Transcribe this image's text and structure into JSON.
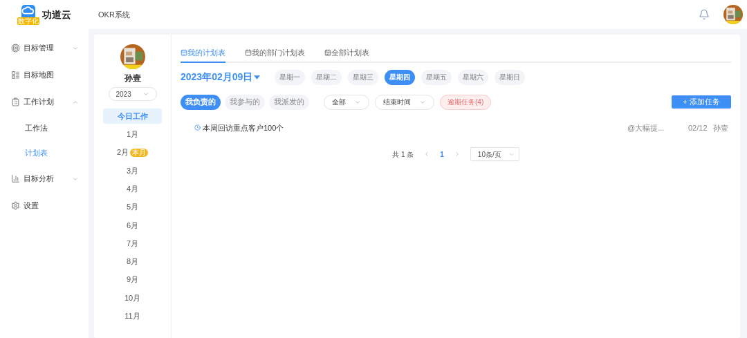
{
  "header": {
    "brand": "功道云",
    "badge": "数字化",
    "system": "OKR系统"
  },
  "sidebar": {
    "items": [
      {
        "label": "目标管理",
        "expanded": false,
        "selected": false
      },
      {
        "label": "目标地图",
        "selected": false
      },
      {
        "label": "工作计划",
        "expanded": true,
        "selected": false,
        "children": [
          {
            "label": "工作法",
            "selected": false
          },
          {
            "label": "计划表",
            "selected": true
          }
        ]
      },
      {
        "label": "目标分析",
        "expanded": false,
        "selected": false
      },
      {
        "label": "设置",
        "selected": false
      }
    ]
  },
  "profile": {
    "name": "孙壹",
    "year": "2023"
  },
  "months": [
    {
      "label": "今日工作",
      "selected": true
    },
    {
      "label": "1月",
      "selected": false
    },
    {
      "label": "2月",
      "selected": false,
      "badge": "本月"
    },
    {
      "label": "3月",
      "selected": false
    },
    {
      "label": "4月",
      "selected": false
    },
    {
      "label": "5月",
      "selected": false
    },
    {
      "label": "6月",
      "selected": false
    },
    {
      "label": "7月",
      "selected": false
    },
    {
      "label": "8月",
      "selected": false
    },
    {
      "label": "9月",
      "selected": false
    },
    {
      "label": "10月",
      "selected": false
    },
    {
      "label": "11月",
      "selected": false
    }
  ],
  "tabs": [
    {
      "label": "我的计划表",
      "selected": true
    },
    {
      "label": "我的部门计划表",
      "selected": false
    },
    {
      "label": "全部计划表",
      "selected": false
    }
  ],
  "date": "2023年02月09日",
  "weekdays": [
    {
      "label": "星期一",
      "selected": false
    },
    {
      "label": "星期二",
      "selected": false
    },
    {
      "label": "星期三",
      "selected": false
    },
    {
      "label": "星期四",
      "selected": true
    },
    {
      "label": "星期五",
      "selected": false
    },
    {
      "label": "星期六",
      "selected": false
    },
    {
      "label": "星期日",
      "selected": false
    }
  ],
  "scopes": [
    {
      "label": "我负责的",
      "selected": true
    },
    {
      "label": "我参与的",
      "selected": false
    },
    {
      "label": "我派发的",
      "selected": false
    }
  ],
  "dropdowns": [
    {
      "value": "全部"
    },
    {
      "value": "结束时间"
    }
  ],
  "overdue": "逾期任务(4)",
  "add_button": "+ 添加任务",
  "tasks": [
    {
      "title": "本周回访重点客户100个",
      "goal": "@大幅提...",
      "date": "02/12",
      "owner": "孙壹"
    }
  ],
  "pagination": {
    "total": "共 1 条",
    "pages": [
      {
        "label": "1",
        "selected": true
      }
    ],
    "page_size": "10条/页"
  }
}
